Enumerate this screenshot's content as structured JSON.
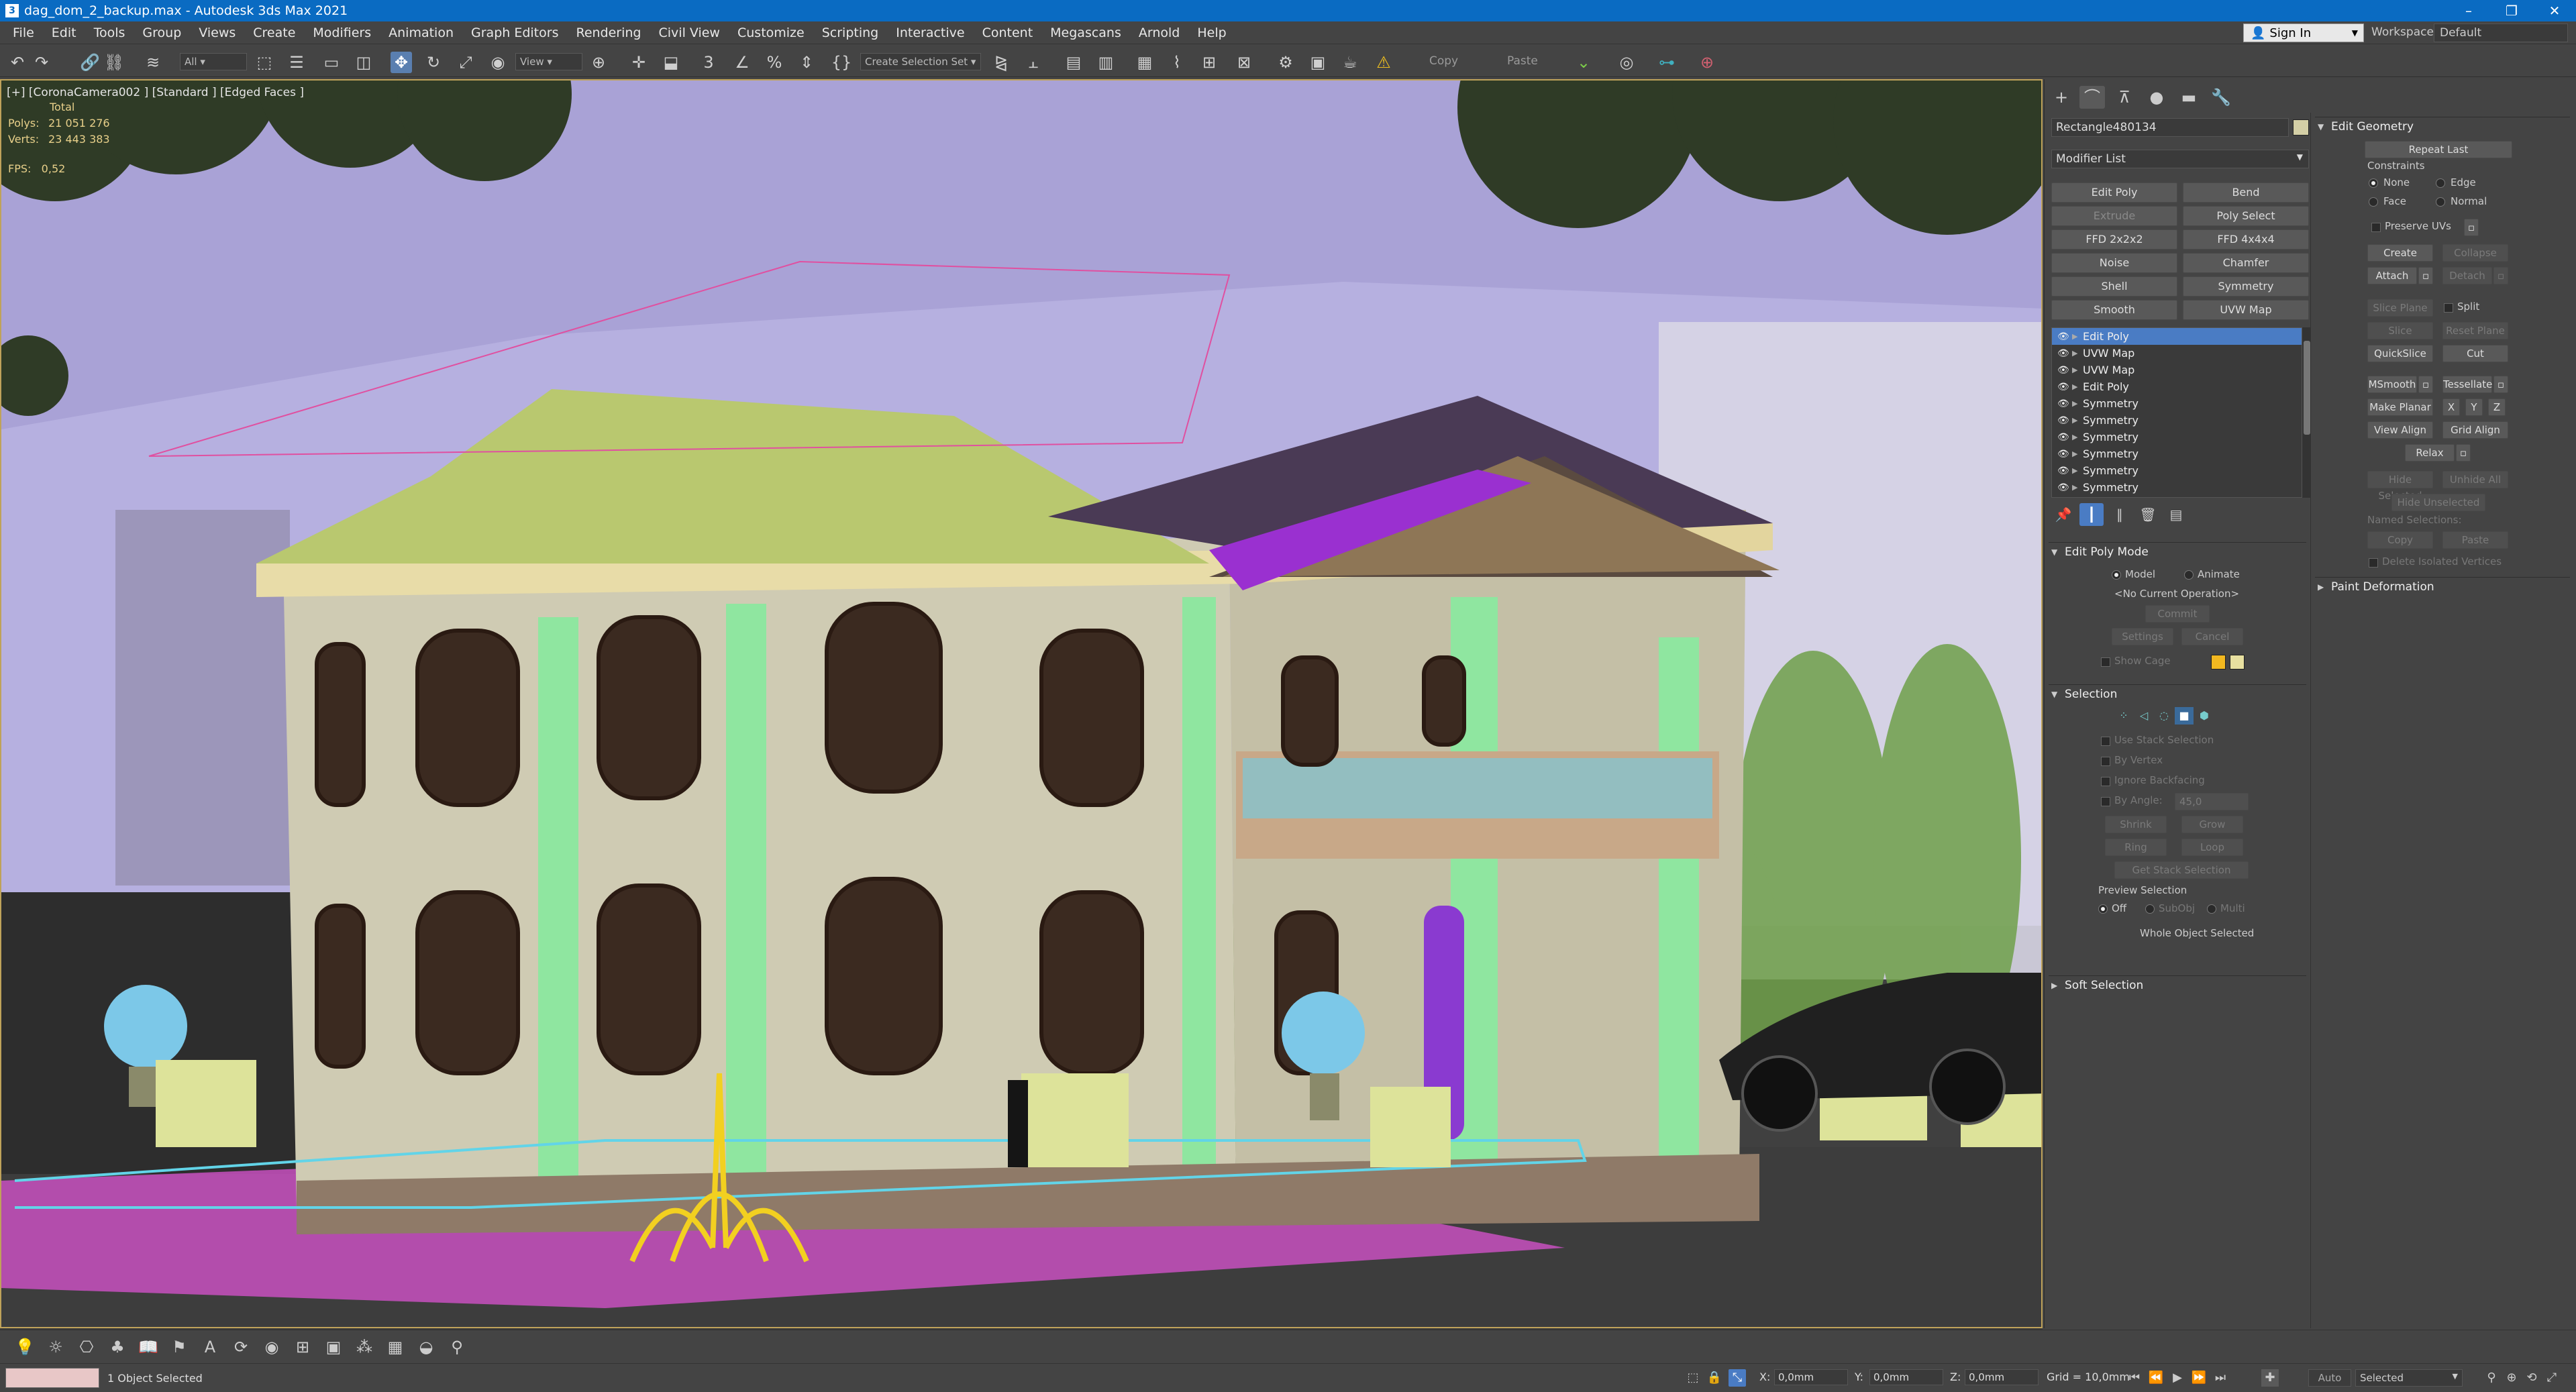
{
  "window": {
    "title": "dag_dom_2_backup.max - Autodesk 3ds Max 2021"
  },
  "menu": [
    "File",
    "Edit",
    "Tools",
    "Group",
    "Views",
    "Create",
    "Modifiers",
    "Animation",
    "Graph Editors",
    "Rendering",
    "Civil View",
    "Customize",
    "Scripting",
    "Interactive",
    "Content",
    "Megascans",
    "Arnold",
    "Help"
  ],
  "account": {
    "sign_in": "Sign In",
    "workspaces_label": "Workspaces:",
    "workspace": "Default"
  },
  "toolbar": {
    "filter": "All",
    "ref_coord": "View",
    "selection_set": "Create Selection Set",
    "copy": "Copy",
    "paste": "Paste"
  },
  "viewport": {
    "label": "[+] [CoronaCamera002 ] [Standard ] [Edged Faces ]",
    "stats_total": "Total",
    "polys_label": "Polys:",
    "polys": "21 051 276",
    "verts_label": "Verts:",
    "verts": "23 443 383",
    "fps_label": "FPS:",
    "fps": "0,52"
  },
  "panel": {
    "object_name": "Rectangle480134",
    "modifier_list": "Modifier List",
    "modifier_buttons": [
      {
        "label": "Edit Poly",
        "dim": false
      },
      {
        "label": "Bend",
        "dim": false
      },
      {
        "label": "Extrude",
        "dim": true
      },
      {
        "label": "Poly Select",
        "dim": false
      },
      {
        "label": "FFD 2x2x2",
        "dim": false
      },
      {
        "label": "FFD 4x4x4",
        "dim": false
      },
      {
        "label": "Noise",
        "dim": false
      },
      {
        "label": "Chamfer",
        "dim": false
      },
      {
        "label": "Shell",
        "dim": false
      },
      {
        "label": "Symmetry",
        "dim": false
      },
      {
        "label": "Smooth",
        "dim": false
      },
      {
        "label": "UVW Map",
        "dim": false
      }
    ],
    "stack": [
      "Edit Poly",
      "UVW Map",
      "UVW Map",
      "Edit Poly",
      "Symmetry",
      "Symmetry",
      "Symmetry",
      "Symmetry",
      "Symmetry",
      "Symmetry"
    ],
    "edit_poly_mode": {
      "title": "Edit Poly Mode",
      "model": "Model",
      "animate": "Animate",
      "current_op": "<No Current Operation>",
      "commit": "Commit",
      "settings": "Settings",
      "cancel": "Cancel",
      "show_cage": "Show Cage",
      "cage_color1": "#f2b820",
      "cage_color2": "#e8e0a0"
    },
    "selection": {
      "title": "Selection",
      "use_stack": "Use Stack Selection",
      "by_vertex": "By Vertex",
      "ignore_backfacing": "Ignore Backfacing",
      "by_angle": "By Angle:",
      "angle": "45,0",
      "shrink": "Shrink",
      "grow": "Grow",
      "ring": "Ring",
      "loop": "Loop",
      "get_stack": "Get Stack Selection",
      "preview": "Preview Selection",
      "off": "Off",
      "subobj": "SubObj",
      "multi": "Multi",
      "whole_object": "Whole Object Selected"
    },
    "soft_selection": "Soft Selection"
  },
  "geometry": {
    "title": "Edit Geometry",
    "repeat_last": "Repeat Last",
    "constraints": "Constraints",
    "none": "None",
    "edge": "Edge",
    "face": "Face",
    "normal": "Normal",
    "preserve_uvs": "Preserve UVs",
    "create": "Create",
    "collapse": "Collapse",
    "attach": "Attach",
    "detach": "Detach",
    "slice_plane": "Slice Plane",
    "split": "Split",
    "slice": "Slice",
    "reset_plane": "Reset Plane",
    "quickslice": "QuickSlice",
    "cut": "Cut",
    "msmooth": "MSmooth",
    "tessellate": "Tessellate",
    "make_planar": "Make Planar",
    "x": "X",
    "y": "Y",
    "z": "Z",
    "view_align": "View Align",
    "grid_align": "Grid Align",
    "relax": "Relax",
    "hide_selected": "Hide Selected",
    "unhide_all": "Unhide All",
    "hide_unselected": "Hide Unselected",
    "named_selections": "Named Selections:",
    "copy": "Copy",
    "paste": "Paste",
    "delete_isolated": "Delete Isolated Vertices",
    "paint_deformation": "Paint Deformation"
  },
  "status": {
    "selected": "1 Object Selected",
    "x_label": "X:",
    "x": "0,0mm",
    "y_label": "Y:",
    "y": "0,0mm",
    "z_label": "Z:",
    "z": "0,0mm",
    "grid": "Grid = 10,0mm",
    "auto": "Auto",
    "selected_dd": "Selected"
  }
}
